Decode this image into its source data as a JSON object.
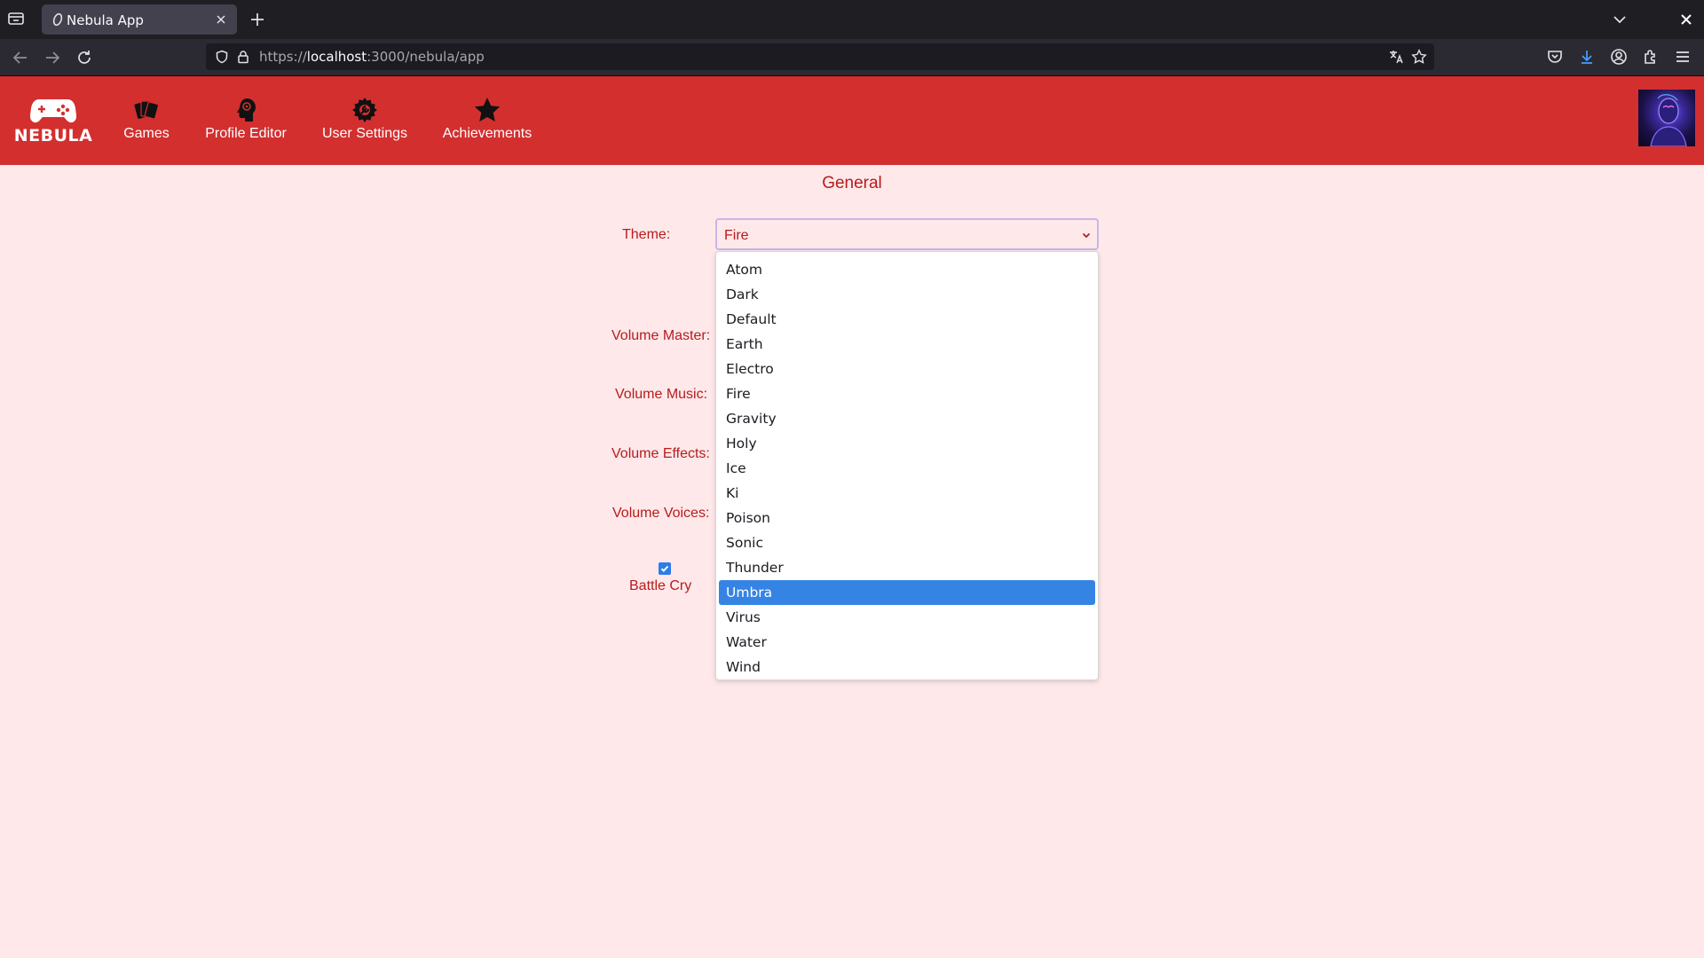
{
  "browser": {
    "tab_title": "Nebula App",
    "url_prefix": "https://",
    "url_host": "localhost",
    "url_rest": ":3000/nebula/app"
  },
  "app": {
    "logo_text": "NEBULA",
    "nav": {
      "games": "Games",
      "profile_editor": "Profile Editor",
      "user_settings": "User Settings",
      "achievements": "Achievements"
    },
    "icons": {
      "logo": "gamepad-icon",
      "games": "cards-icon",
      "profile_editor": "head-gear-icon",
      "user_settings": "gear-wrench-icon",
      "achievements": "star-icon"
    },
    "colors": {
      "header": "#d32f2f",
      "background": "#ffe8ea",
      "label": "#b71c1c",
      "highlight": "#3584e4"
    }
  },
  "settings": {
    "section_title": "General",
    "theme_label": "Theme:",
    "theme_value": "Fire",
    "theme_options": [
      "Atom",
      "Dark",
      "Default",
      "Earth",
      "Electro",
      "Fire",
      "Gravity",
      "Holy",
      "Ice",
      "Ki",
      "Poison",
      "Sonic",
      "Thunder",
      "Umbra",
      "Virus",
      "Water",
      "Wind"
    ],
    "highlighted_option": "Umbra",
    "volume_master_label": "Volume Master:",
    "volume_music_label": "Volume Music:",
    "volume_effects_label": "Volume Effects:",
    "volume_voices_label": "Volume Voices:",
    "battle_cry_label": "Battle Cry",
    "battle_cry_checked": true
  }
}
